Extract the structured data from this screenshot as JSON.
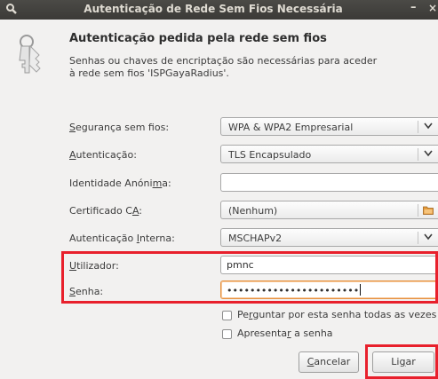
{
  "window": {
    "title": "Autenticação de Rede Sem Fios Necessária",
    "minimize": "–",
    "close": "×"
  },
  "heading": "Autenticação pedida pela rede sem fios",
  "description": {
    "line1": "Senhas ou chaves de encriptação são necessárias para aceder",
    "line2": "à rede sem fios 'ISPGayaRadius'."
  },
  "fields": {
    "security": {
      "label_u": "S",
      "label_rest": "egurança sem fios:",
      "value": "WPA & WPA2 Empresarial"
    },
    "authentication": {
      "label_u": "A",
      "label_rest": "utenticação:",
      "value": "TLS Encapsulado"
    },
    "anon_identity": {
      "label_pre": "Identidade Anóni",
      "label_u": "m",
      "label_rest": "a:",
      "value": ""
    },
    "ca_cert": {
      "label_pre": "Certificado C",
      "label_u": "A",
      "label_rest": ":",
      "value": "(Nenhum)"
    },
    "inner_auth": {
      "label_pre": "Autenticação ",
      "label_u": "I",
      "label_rest": "nterna:",
      "value": "MSCHAPv2"
    },
    "username": {
      "label_u": "U",
      "label_rest": "tilizador:",
      "value": "pmnc"
    },
    "password": {
      "label_u": "S",
      "label_rest": "enha:",
      "value": "•••••••••••••••••••••••"
    }
  },
  "checkboxes": {
    "ask_pw": {
      "pre": "Pe",
      "u": "r",
      "rest": "guntar por esta senha todas as vezes",
      "checked": false
    },
    "show_pw": {
      "pre": "Apresenta",
      "u": "r",
      "rest": " a senha",
      "checked": false
    }
  },
  "buttons": {
    "cancel": {
      "u": "C",
      "rest": "ancelar"
    },
    "connect": {
      "pre": "Li",
      "u": "g",
      "rest": "ar"
    }
  },
  "colors": {
    "highlight": "#e8202c",
    "focus": "#e6923f",
    "titlebar": "#3c3b37"
  }
}
